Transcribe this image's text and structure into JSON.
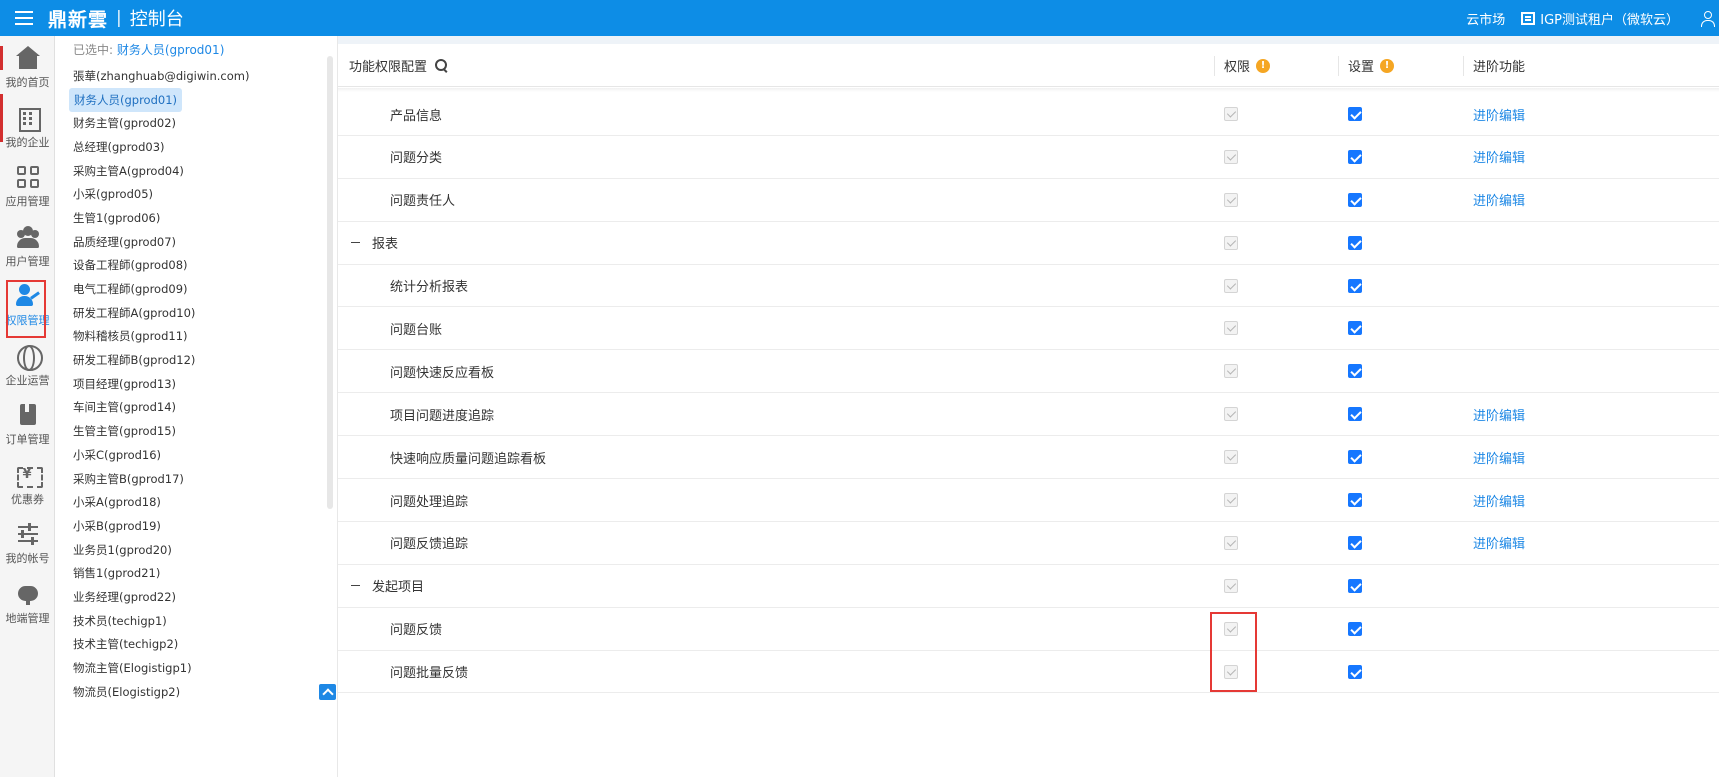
{
  "topbar": {
    "brand": "鼎新雲",
    "separator": "|",
    "console": "控制台",
    "market": "云市场",
    "tenant": "IGP测试租户（微软云）"
  },
  "leftnav": {
    "items": [
      {
        "label": "我的首页",
        "icon": "home-icon"
      },
      {
        "label": "我的企业",
        "icon": "building-icon"
      },
      {
        "label": "应用管理",
        "icon": "apps-grid-icon"
      },
      {
        "label": "用户管理",
        "icon": "users-icon"
      },
      {
        "label": "权限管理",
        "icon": "user-key-icon",
        "active": true
      },
      {
        "label": "企业运营",
        "icon": "globe-icon"
      },
      {
        "label": "订单管理",
        "icon": "book-icon"
      },
      {
        "label": "优惠券",
        "icon": "coupon-icon"
      },
      {
        "label": "我的帐号",
        "icon": "sliders-icon"
      },
      {
        "label": "地端管理",
        "icon": "cloud-icon"
      }
    ]
  },
  "userpanel": {
    "selected_prefix": "已选中:",
    "selected_value": "财务人员(gprod01)",
    "users": [
      "張華(zhanghuab@digiwin.com)",
      "财务人员(gprod01)",
      "财务主管(gprod02)",
      "总经理(gprod03)",
      "采购主管A(gprod04)",
      "小采(gprod05)",
      "生管1(gprod06)",
      "品质经理(gprod07)",
      "设备工程師(gprod08)",
      "电气工程師(gprod09)",
      "研发工程師A(gprod10)",
      "物料稽核员(gprod11)",
      "研发工程師B(gprod12)",
      "项目经理(gprod13)",
      "车间主管(gprod14)",
      "生管主管(gprod15)",
      "小采C(gprod16)",
      "采购主管B(gprod17)",
      "小采A(gprod18)",
      "小采B(gprod19)",
      "业务员1(gprod20)",
      "销售1(gprod21)",
      "业务经理(gprod22)",
      "技术员(techigp1)",
      "技术主管(techigp2)",
      "物流主管(Elogistigp1)",
      "物流员(Elogistigp2)"
    ],
    "active_index": 1
  },
  "table": {
    "col_function": "功能权限配置",
    "col_permission": "权限",
    "col_setting": "设置",
    "col_advanced": "进阶功能",
    "info_glyph": "!",
    "rows": [
      {
        "name": "产品信息",
        "type": "child",
        "advanced": "进阶编辑"
      },
      {
        "name": "问题分类",
        "type": "child",
        "advanced": "进阶编辑"
      },
      {
        "name": "问题责任人",
        "type": "child",
        "advanced": "进阶编辑"
      },
      {
        "name": "报表",
        "type": "group",
        "advanced": ""
      },
      {
        "name": "统计分析报表",
        "type": "child",
        "advanced": ""
      },
      {
        "name": "问题台账",
        "type": "child",
        "advanced": ""
      },
      {
        "name": "问题快速反应看板",
        "type": "child",
        "advanced": ""
      },
      {
        "name": "项目问题进度追踪",
        "type": "child",
        "advanced": "进阶编辑"
      },
      {
        "name": "快速响应质量问题追踪看板",
        "type": "child",
        "advanced": "进阶编辑"
      },
      {
        "name": "问题处理追踪",
        "type": "child",
        "advanced": "进阶编辑"
      },
      {
        "name": "问题反馈追踪",
        "type": "child",
        "advanced": "进阶编辑"
      },
      {
        "name": "发起项目",
        "type": "group",
        "advanced": ""
      },
      {
        "name": "问题反馈",
        "type": "child",
        "advanced": ""
      },
      {
        "name": "问题批量反馈",
        "type": "child",
        "advanced": ""
      }
    ]
  },
  "colors": {
    "topbar": "#0d8de6",
    "accent": "#1e88e5",
    "checkbox": "#1677ff",
    "info": "#f5a623",
    "highlight": "#e53935"
  }
}
